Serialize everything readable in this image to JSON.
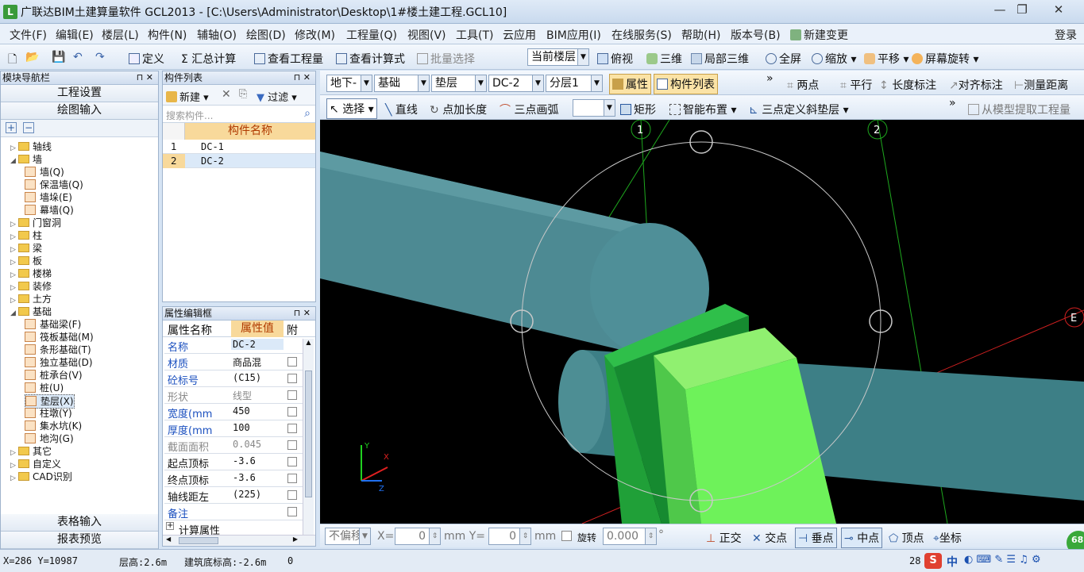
{
  "window": {
    "title": "广联达BIM土建算量软件 GCL2013 - [C:\\Users\\Administrator\\Desktop\\1#楼土建工程.GCL10]",
    "logo": "L",
    "minimize": "—",
    "restore": "❐",
    "close": "✕"
  },
  "menu": [
    "文件(F)",
    "编辑(E)",
    "楼层(L)",
    "构件(N)",
    "辅轴(O)",
    "绘图(D)",
    "修改(M)",
    "工程量(Q)",
    "视图(V)",
    "工具(T)",
    "云应用",
    "BIM应用(I)",
    "在线服务(S)",
    "帮助(H)",
    "版本号(B)",
    "新建变更"
  ],
  "login": "登录",
  "toolbar1": {
    "define": "定义",
    "sum_calc": "Σ 汇总计算",
    "view_qty": "查看工程量",
    "view_formula": "查看计算式",
    "batch_select": "批量选择",
    "current_floor": "当前楼层",
    "top_view": "俯视",
    "three_d": "三维",
    "local_3d": "局部三维",
    "full_screen": "全屏",
    "zoom": "缩放",
    "pan": "平移",
    "rotate": "屏幕旋转"
  },
  "left_nav": {
    "header": "模块导航栏",
    "project_settings": "工程设置",
    "drawing_input": "绘图输入",
    "table_input": "表格输入",
    "report_preview": "报表预览",
    "tree": [
      {
        "label": "轴线",
        "level": 0,
        "toggle": "▷"
      },
      {
        "label": "墙",
        "level": 0,
        "toggle": "◢"
      },
      {
        "label": "墙(Q)",
        "level": 1
      },
      {
        "label": "保温墙(Q)",
        "level": 1
      },
      {
        "label": "墙垛(E)",
        "level": 1
      },
      {
        "label": "幕墙(Q)",
        "level": 1
      },
      {
        "label": "门窗洞",
        "level": 0,
        "toggle": "▷"
      },
      {
        "label": "柱",
        "level": 0,
        "toggle": "▷"
      },
      {
        "label": "梁",
        "level": 0,
        "toggle": "▷"
      },
      {
        "label": "板",
        "level": 0,
        "toggle": "▷"
      },
      {
        "label": "楼梯",
        "level": 0,
        "toggle": "▷"
      },
      {
        "label": "装修",
        "level": 0,
        "toggle": "▷"
      },
      {
        "label": "土方",
        "level": 0,
        "toggle": "▷"
      },
      {
        "label": "基础",
        "level": 0,
        "toggle": "◢"
      },
      {
        "label": "基础梁(F)",
        "level": 1
      },
      {
        "label": "筏板基础(M)",
        "level": 1
      },
      {
        "label": "条形基础(T)",
        "level": 1
      },
      {
        "label": "独立基础(D)",
        "level": 1
      },
      {
        "label": "桩承台(V)",
        "level": 1
      },
      {
        "label": "桩(U)",
        "level": 1
      },
      {
        "label": "垫层(X)",
        "level": 1,
        "selected": true
      },
      {
        "label": "柱墩(Y)",
        "level": 1
      },
      {
        "label": "集水坑(K)",
        "level": 1
      },
      {
        "label": "地沟(G)",
        "level": 1
      },
      {
        "label": "其它",
        "level": 0,
        "toggle": "▷"
      },
      {
        "label": "自定义",
        "level": 0,
        "toggle": "▷"
      },
      {
        "label": "CAD识别",
        "level": 0,
        "toggle": "▷"
      }
    ]
  },
  "component_list": {
    "header": "构件列表",
    "new": "新建",
    "filter": "过滤",
    "search_placeholder": "搜索构件...",
    "column": "构件名称",
    "rows": [
      {
        "no": "1",
        "name": "DC-1"
      },
      {
        "no": "2",
        "name": "DC-2"
      }
    ]
  },
  "property_editor": {
    "header": "属性编辑框",
    "col_name": "属性名称",
    "col_value": "属性值",
    "col_attach": "附",
    "rows": [
      {
        "name": "名称",
        "value": "DC-2",
        "blue": true
      },
      {
        "name": "材质",
        "value": "商品混",
        "blue": true
      },
      {
        "name": "砼标号",
        "value": "(C15)",
        "blue": true
      },
      {
        "name": "形状",
        "value": "线型",
        "blue": false,
        "gray": true
      },
      {
        "name": "宽度(mm",
        "value": "450",
        "blue": true
      },
      {
        "name": "厚度(mm",
        "value": "100",
        "blue": true
      },
      {
        "name": "截面面积",
        "value": "0.045",
        "blue": false,
        "gray": true
      },
      {
        "name": "起点顶标",
        "value": "-3.6",
        "blue": false
      },
      {
        "name": "终点顶标",
        "value": "-3.6",
        "blue": false
      },
      {
        "name": "轴线距左",
        "value": "(225)",
        "blue": false
      },
      {
        "name": "备注",
        "value": "",
        "blue": true
      },
      {
        "name": "计算属性",
        "value": "",
        "blue": false
      }
    ]
  },
  "toolbar2": {
    "floor": "地下-",
    "category": "基础",
    "type": "垫层",
    "component": "DC-2",
    "layer": "分层1",
    "property": "属性",
    "comp_list": "构件列表",
    "two_point": "两点",
    "parallel": "平行",
    "length_mark": "长度标注",
    "align_mark": "对齐标注",
    "measure": "测量距离"
  },
  "toolbar3": {
    "select": "选择",
    "line": "直线",
    "add_length": "点加长度",
    "arc": "三点画弧",
    "rect": "矩形",
    "smart": "智能布置",
    "slope": "三点定义斜垫层",
    "extract": "从模型提取工程量"
  },
  "canvas": {
    "axis_labels": [
      "1",
      "2",
      "E"
    ],
    "gizmo": {
      "x": "X",
      "y": "Y",
      "z": "Z"
    }
  },
  "coord_bar": {
    "no_offset": "不偏移",
    "x_label": "X=",
    "x_value": "0",
    "y_label": "mm Y=",
    "y_value": "0",
    "unit": "mm",
    "rotate_label": "旋转",
    "rotate_value": "0.000",
    "degree": "°",
    "ortho": "正交",
    "intersect": "交点",
    "perp": "垂点",
    "midpoint": "中点",
    "vertex": "顶点",
    "coord": "坐标"
  },
  "status": {
    "coords": "X=286 Y=10987",
    "floor_height": "层高:2.6m",
    "base_elev": "建筑底标高:-2.6m",
    "extra": "0",
    "right_num": "28",
    "badge": "68",
    "ime": "中"
  }
}
